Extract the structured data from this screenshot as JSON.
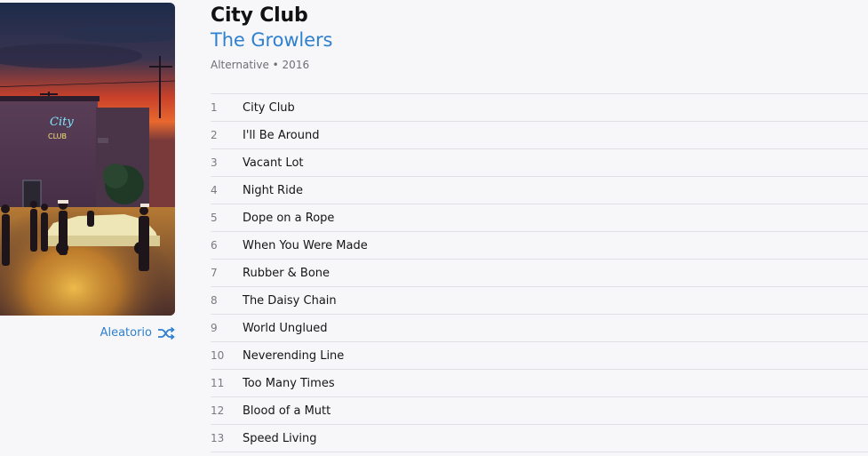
{
  "album": {
    "title": "City Club",
    "artist": "The Growlers",
    "meta": "Alternative • 2016",
    "artwork_sign_script": "City",
    "artwork_sign_text": "CLUB"
  },
  "shuffle": {
    "label": "Aleatorio",
    "icon": "shuffle-icon"
  },
  "tracks": [
    {
      "number": "1",
      "name": "City Club"
    },
    {
      "number": "2",
      "name": "I'll Be Around"
    },
    {
      "number": "3",
      "name": "Vacant Lot"
    },
    {
      "number": "4",
      "name": "Night Ride"
    },
    {
      "number": "5",
      "name": "Dope on a Rope"
    },
    {
      "number": "6",
      "name": "When You Were Made"
    },
    {
      "number": "7",
      "name": "Rubber & Bone"
    },
    {
      "number": "8",
      "name": "The Daisy Chain"
    },
    {
      "number": "9",
      "name": "World Unglued"
    },
    {
      "number": "10",
      "name": "Neverending Line"
    },
    {
      "number": "11",
      "name": "Too Many Times"
    },
    {
      "number": "12",
      "name": "Blood of a Mutt"
    },
    {
      "number": "13",
      "name": "Speed Living"
    }
  ],
  "colors": {
    "accent": "#2f80ce",
    "background": "#f7f7f9",
    "divider": "#e1e1e5"
  }
}
